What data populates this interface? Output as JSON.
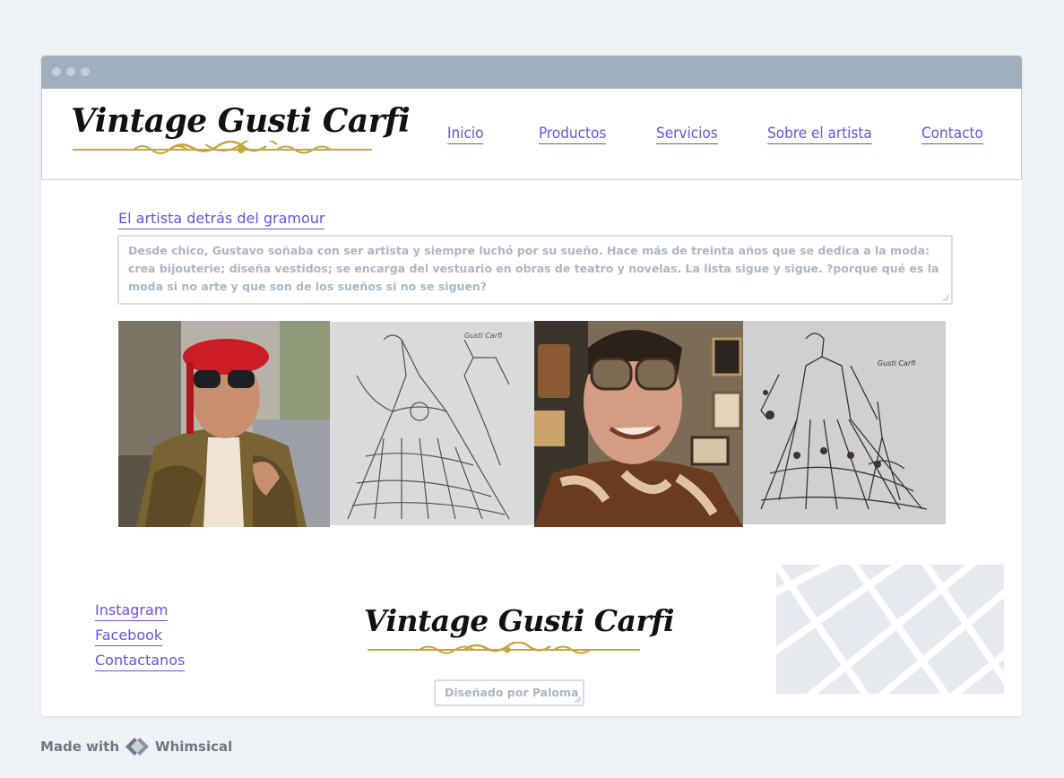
{
  "header": {
    "logo": "Vintage Gusti Carfi",
    "nav": [
      "Inicio",
      "Productos",
      "Servicios",
      "Sobre el artista",
      "Contacto"
    ]
  },
  "main": {
    "section_title": "El artista detrás del gramour",
    "bio": "Desde chico, Gustavo soñaba con ser artista y siempre luchó por su sueño. Hace más de treinta años que se dedica a la moda: crea bijouterie; diseña vestidos; se encarga del vestuario en obras de teatro y novelas. La lista sigue y sigue. ?porque qué es la moda si no arte y que son de los sueños si no se siguen?"
  },
  "footer": {
    "links": [
      "Instagram",
      "Facebook",
      "Contactanos"
    ],
    "logo": "Vintage Gusti Carfi",
    "credit": "Diseñado por Paloma"
  },
  "branding": {
    "made_with": "Made with",
    "brand": "Whimsical"
  },
  "colors": {
    "link": "#6a52e8",
    "titlebar": "#9fafbd",
    "gold": "#c9a43a",
    "canvas": "#eff2f5"
  }
}
